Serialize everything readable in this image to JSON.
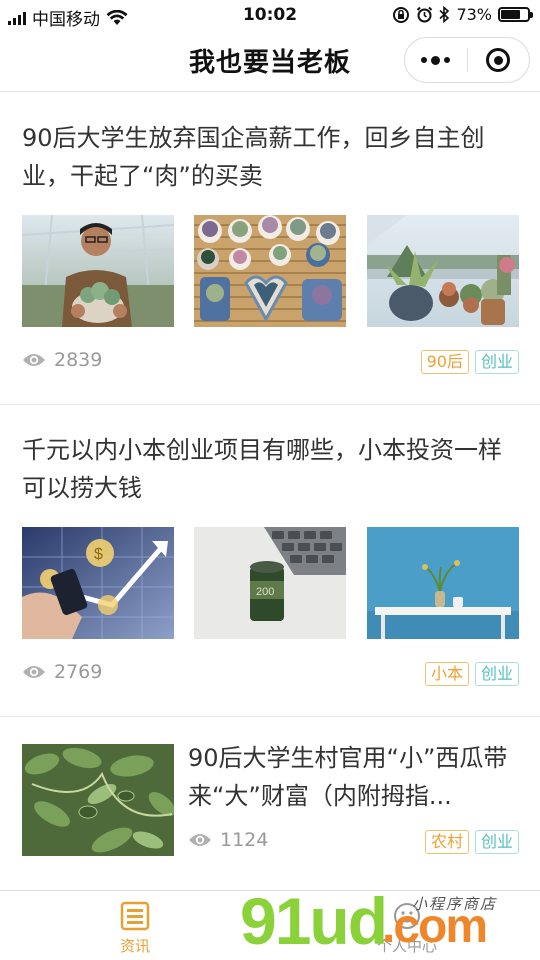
{
  "status_bar": {
    "carrier": "中国移动",
    "time": "10:02",
    "battery": "73%",
    "battery_level": 0.73
  },
  "nav": {
    "title": "我也要当老板"
  },
  "articles": [
    {
      "title": "90后大学生放弃国企高薪工作，回乡自主创业，干起了“肉”的买卖",
      "views": "2839",
      "tags": [
        "90后",
        "创业"
      ]
    },
    {
      "title": "千元以内小本创业项目有哪些，小本投资一样可以捞大钱",
      "views": "2769",
      "tags": [
        "小本",
        "创业"
      ]
    },
    {
      "title": "90后大学生村官用“小”西瓜带来“大”财富（内附拇指...",
      "views": "1124",
      "tags": [
        "农村",
        "创业"
      ]
    }
  ],
  "tab_bar": {
    "items": [
      {
        "label": "资讯",
        "icon": "news-list-icon",
        "active": true
      },
      {
        "label": "个人中心",
        "icon": "user-face-icon",
        "active": false
      }
    ],
    "active_color": "#e8a030"
  },
  "watermark": {
    "brand": "91ud",
    "suffix": ".com",
    "tagline": "小程序商店"
  },
  "colors": {
    "tag_orange": "#f0a030",
    "tag_teal": "#55c0c0",
    "watermark_green": "#8bd23a",
    "watermark_orange": "#f0862a"
  }
}
